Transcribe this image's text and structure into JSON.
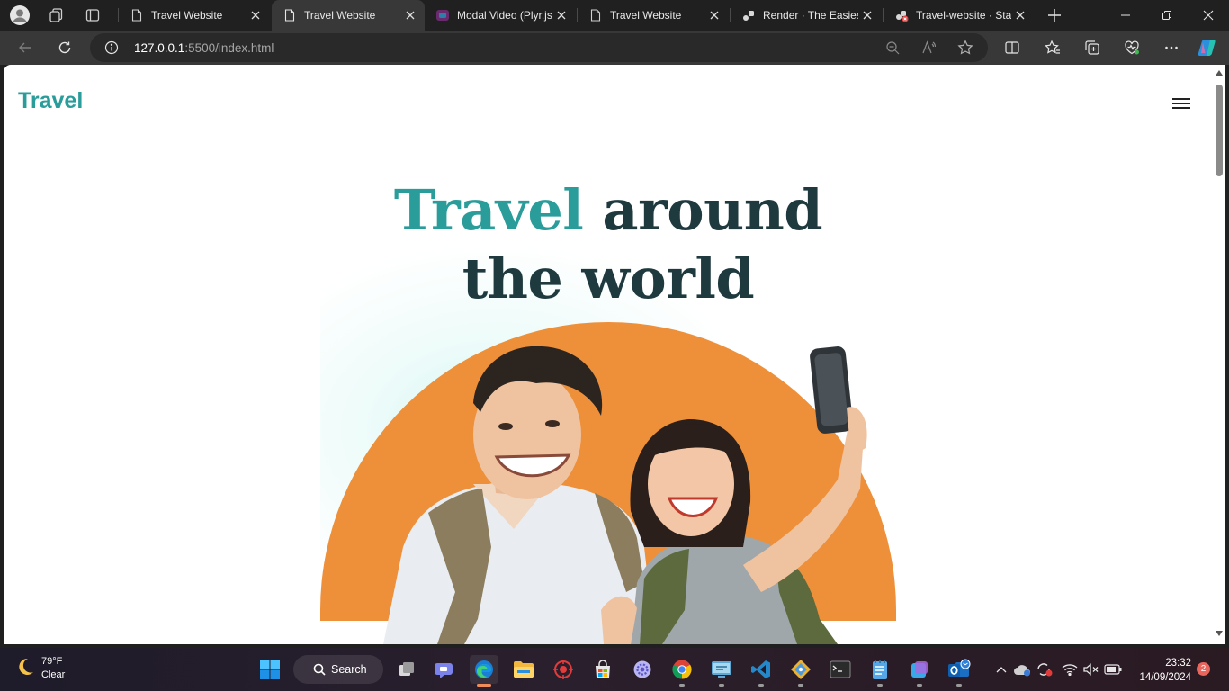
{
  "browser": {
    "tabs": [
      {
        "title": "Travel Website",
        "active": false
      },
      {
        "title": "Travel Website",
        "active": true
      },
      {
        "title": "Modal Video (Plyr.js)",
        "active": false
      },
      {
        "title": "Travel Website",
        "active": false
      },
      {
        "title": "Render · The Easiest",
        "active": false
      },
      {
        "title": "Travel-website · Stat",
        "active": false
      }
    ],
    "url_host": "127.0.0.1",
    "url_path": ":5500/index.html"
  },
  "page": {
    "logo": "Travel",
    "hero_accent": "Travel",
    "hero_rest_line1": " around",
    "hero_line2": "the world",
    "colors": {
      "brand": "#2a9d9b",
      "hero_arc": "#ee8f3a",
      "heading": "#1f3a3f"
    }
  },
  "taskbar": {
    "weather_temp": "79°F",
    "weather_cond": "Clear",
    "search_label": "Search",
    "time": "23:32",
    "date": "14/09/2024",
    "notification_count": "2"
  }
}
